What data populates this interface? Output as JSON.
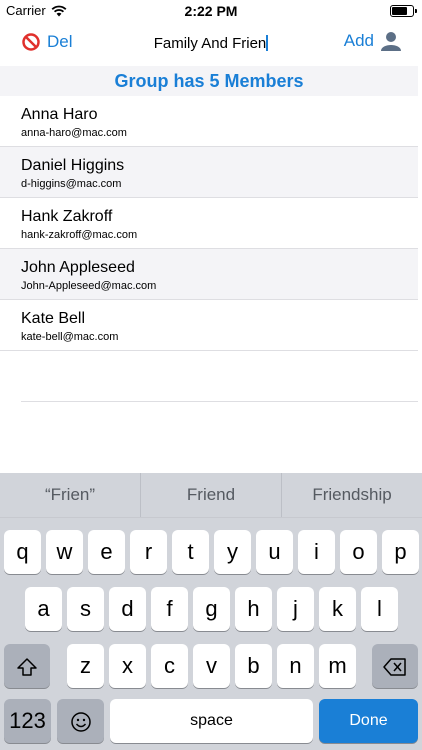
{
  "status_bar": {
    "carrier": "Carrier",
    "time": "2:22 PM",
    "battery_level": 0.8
  },
  "nav": {
    "delete_label": "Del",
    "title_value": "Family And Frien",
    "add_label": "Add"
  },
  "group_banner": "Group has 5 Members",
  "members": [
    {
      "name": "Anna Haro",
      "email": "anna-haro@mac.com"
    },
    {
      "name": "Daniel Higgins",
      "email": "d-higgins@mac.com"
    },
    {
      "name": "Hank Zakroff",
      "email": "hank-zakroff@mac.com"
    },
    {
      "name": "John Appleseed",
      "email": "John-Appleseed@mac.com"
    },
    {
      "name": "Kate Bell",
      "email": "kate-bell@mac.com"
    }
  ],
  "keyboard": {
    "suggestions": [
      "“Frien”",
      "Friend",
      "Friendship"
    ],
    "row1": [
      "q",
      "w",
      "e",
      "r",
      "t",
      "y",
      "u",
      "i",
      "o",
      "p"
    ],
    "row2": [
      "a",
      "s",
      "d",
      "f",
      "g",
      "h",
      "j",
      "k",
      "l"
    ],
    "row3": [
      "z",
      "x",
      "c",
      "v",
      "b",
      "n",
      "m"
    ],
    "numbers_label": "123",
    "space_label": "space",
    "done_label": "Done"
  }
}
